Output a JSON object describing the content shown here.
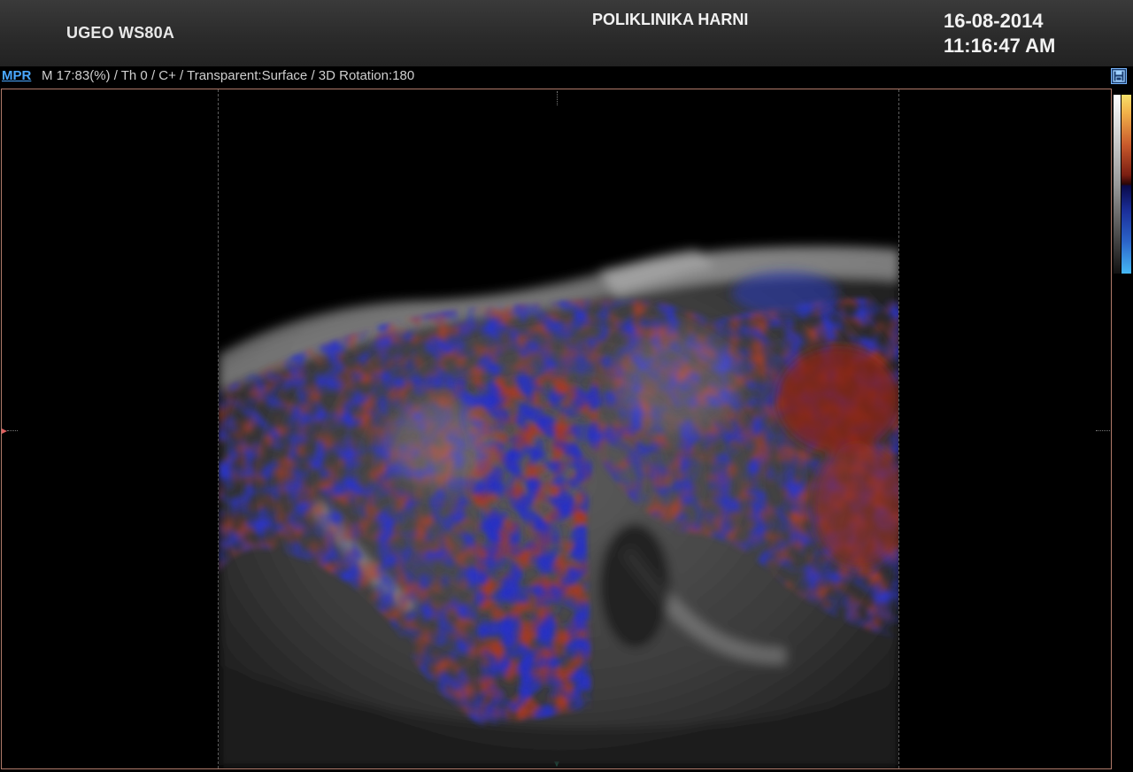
{
  "header": {
    "device_name": "UGEO WS80A",
    "clinic_name": "POLIKLINIKA HARNI",
    "date": "16-08-2014",
    "time": "11:16:47 AM"
  },
  "info_line": {
    "mode_label": "MPR",
    "params": "M 17:83(%) / Th 0 / C+ / Transparent:Surface / 3D Rotation:180"
  },
  "icons": {
    "save": "save-icon"
  },
  "colors": {
    "doppler_red": "#b8402a",
    "doppler_blue": "#2a35c8",
    "viewport_border": "#b07a6a",
    "link_blue": "#4aa8ff"
  }
}
